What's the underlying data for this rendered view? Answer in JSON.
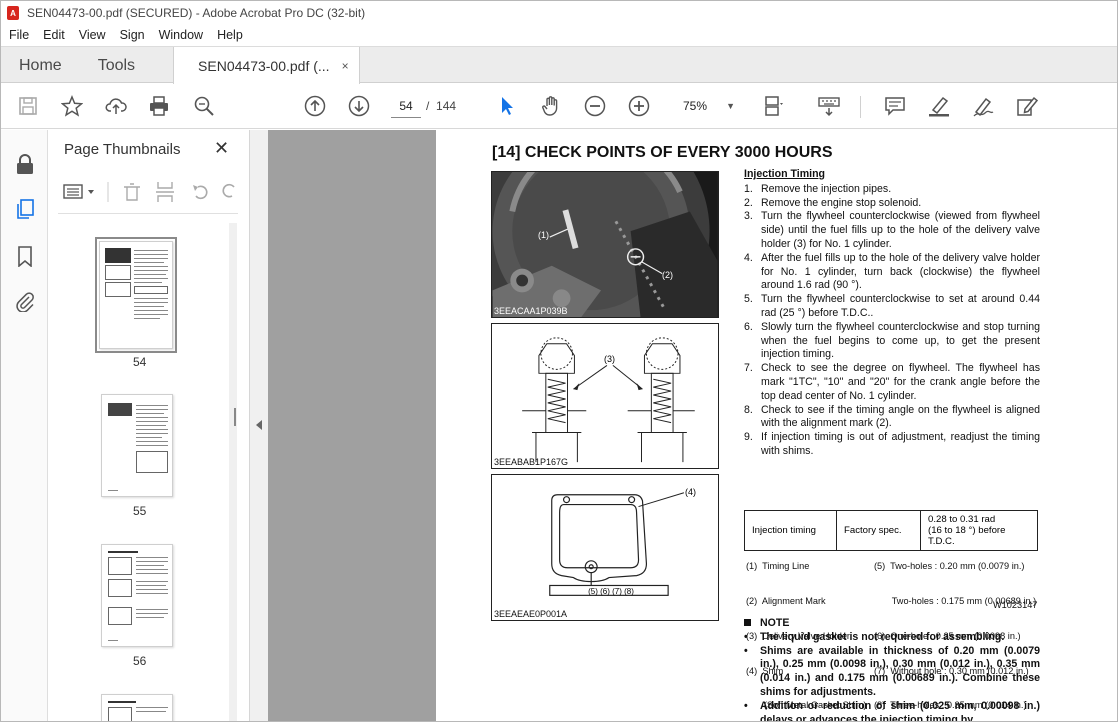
{
  "window": {
    "title": "SEN04473-00.pdf (SECURED) - Adobe Acrobat Pro DC (32-bit)",
    "icon": "acrobat-icon"
  },
  "menu": [
    "File",
    "Edit",
    "View",
    "Sign",
    "Window",
    "Help"
  ],
  "tabs": {
    "home": "Home",
    "tools": "Tools",
    "document": "SEN04473-00.pdf (...",
    "close": "×"
  },
  "toolbar": {
    "page_current": "54",
    "page_sep": "/",
    "page_total": "144",
    "zoom": "75%",
    "icons": [
      "save-icon",
      "star-icon",
      "upload-icon",
      "print-icon",
      "search-icon",
      "prev-page-icon",
      "next-page-icon",
      "select-cursor-icon",
      "hand-icon",
      "zoom-out-icon",
      "zoom-in-icon",
      "fit-page-icon",
      "keyboard-icon",
      "comment-icon",
      "highlight-icon",
      "sign-icon",
      "edit-pdf-icon"
    ]
  },
  "thumbnails_panel": {
    "title": "Page Thumbnails",
    "close": "✕",
    "pages": [
      "54",
      "55",
      "56"
    ]
  },
  "document": {
    "heading": "[14] CHECK POINTS OF EVERY 3000 HOURS",
    "subheading": "Injection Timing",
    "figures": {
      "fig1_label": "3EEACAA1P039B",
      "fig2_label": "3EEABAB1P167G",
      "fig3_label": "3EEAEAE0P001A",
      "callout_1": "(1)",
      "callout_2": "(2)",
      "callout_3": "(3)",
      "callout_4": "(4)",
      "shim_row": "(5) (6) (7) (8)"
    },
    "steps": [
      {
        "n": "1.",
        "t": "Remove the injection pipes."
      },
      {
        "n": "2.",
        "t": "Remove the engine stop solenoid."
      },
      {
        "n": "3.",
        "t": "Turn the flywheel counterclockwise (viewed from flywheel side) until the fuel fills up to the hole of the delivery valve holder (3) for No. 1 cylinder."
      },
      {
        "n": "4.",
        "t": "After the fuel fills up to the hole of the delivery valve holder for No. 1 cylinder, turn back (clockwise) the flywheel around 1.6 rad (90 °)."
      },
      {
        "n": "5.",
        "t": "Turn the flywheel counterclockwise to set at around 0.44 rad (25 °) before T.D.C.."
      },
      {
        "n": "6.",
        "t": "Slowly turn the flywheel counterclockwise and stop turning when the fuel begins to come up, to get the present injection timing."
      },
      {
        "n": "7.",
        "t": "Check to see the degree on flywheel. The flywheel has mark \"1TC\", \"10\" and \"20\" for the crank angle before the top dead center of No. 1 cylinder."
      },
      {
        "n": "8.",
        "t": "Check to see if the timing angle on the flywheel is aligned with the alignment mark (2)."
      },
      {
        "n": "9.",
        "t": "If injection timing is out of adjustment, readjust the timing with shims."
      }
    ],
    "spec_table": {
      "item": "Injection timing",
      "kind": "Factory spec.",
      "value_line1": "0.28 to 0.31 rad",
      "value_line2": "(16 to 18 °) before T.D.C."
    },
    "legend_left": [
      "(1)  Timing Line",
      "(2)  Alignment Mark",
      "(3)  Delivery Valve Holder",
      "(4)  Shim",
      "       (Soft Metal Gasket Shim)"
    ],
    "legend_right": [
      "(5)  Two-holes : 0.20 mm (0.0079 in.)",
      "       Two-holes : 0.175 mm (0.00689 in.)",
      "(6)  One-hole : 0.25 mm (0.0098 in.)",
      "(7)  Without hole : 0.30 mm (0.012 in.)",
      "(8)  Three-holes : 0.35 mm (0.014 in.)"
    ],
    "code": "W1023147",
    "note_title": "NOTE",
    "notes": [
      "The liquid gasket is not required for assembling.",
      "Shims are available in thickness of 0.20 mm (0.0079 in.), 0.25 mm (0.0098 in.), 0.30 mm (0.012 in.), 0.35 mm (0.014 in.) and 0.175 mm (0.00689 in.). Combine these shims for adjustments.",
      "Addition or reduction of shim (0.025 mm, 0.00098 in.) delays or advances the injection timing by"
    ]
  }
}
